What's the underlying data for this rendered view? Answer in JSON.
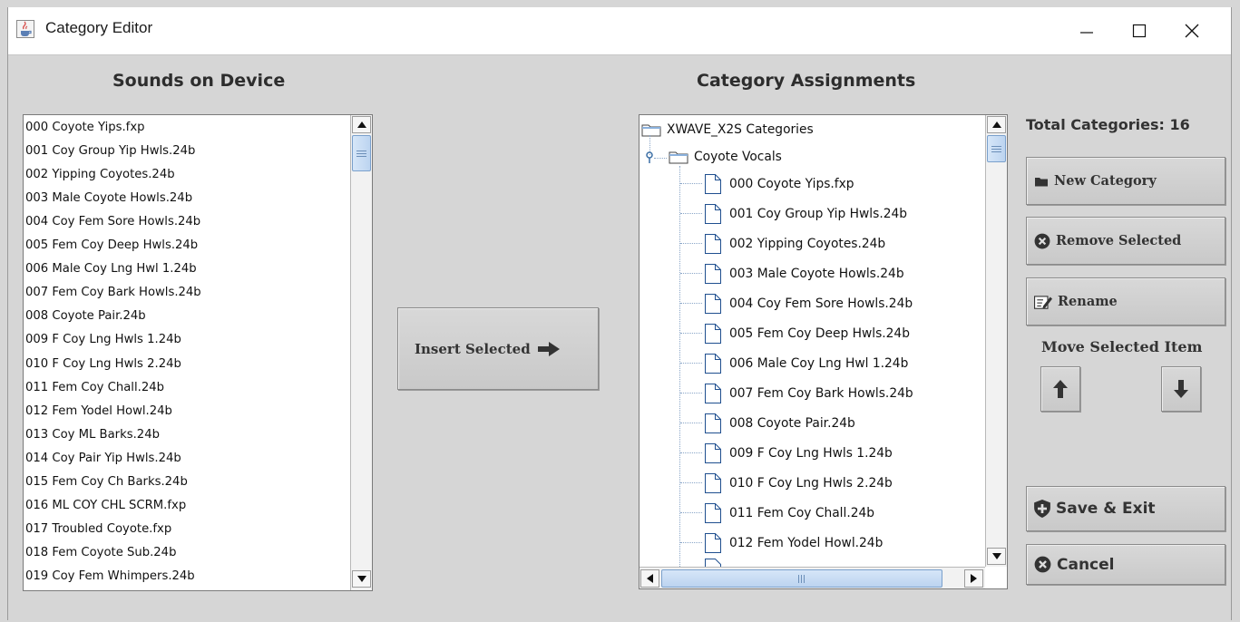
{
  "window": {
    "title": "Category Editor",
    "app_icon": "java-cup-icon",
    "controls": {
      "minimize": "minimize-icon",
      "maximize": "maximize-icon",
      "close": "close-icon"
    }
  },
  "left_panel": {
    "heading": "Sounds on Device",
    "items": [
      "000 Coyote Yips.fxp",
      "001 Coy Group Yip Hwls.24b",
      "002 Yipping Coyotes.24b",
      "003 Male Coyote Howls.24b",
      "004 Coy Fem Sore Howls.24b",
      "005 Fem Coy Deep Hwls.24b",
      "006 Male Coy Lng Hwl 1.24b",
      "007 Fem Coy Bark Howls.24b",
      "008 Coyote Pair.24b",
      "009 F Coy Lng Hwls 1.24b",
      "010 F Coy Lng Hwls 2.24b",
      "011 Fem Coy Chall.24b",
      "012 Fem Yodel Howl.24b",
      "013 Coy ML Barks.24b",
      "014 Coy Pair Yip Hwls.24b",
      "015 Fem Coy Ch Barks.24b",
      "016 ML COY CHL SCRM.fxp",
      "017 Troubled Coyote.fxp",
      "018 Fem Coyote Sub.24b",
      "019 Coy Fem Whimpers.24b"
    ]
  },
  "insert_button": {
    "label": "Insert Selected",
    "icon": "arrow-right-icon"
  },
  "right_panel": {
    "heading": "Category Assignments",
    "root_label": "XWAVE_X2S Categories",
    "category_label": "Coyote Vocals",
    "items": [
      "000 Coyote Yips.fxp",
      "001 Coy Group Yip Hwls.24b",
      "002 Yipping Coyotes.24b",
      "003 Male Coyote Howls.24b",
      "004 Coy Fem Sore Howls.24b",
      "005 Fem Coy Deep Hwls.24b",
      "006 Male Coy Lng Hwl 1.24b",
      "007 Fem Coy Bark Howls.24b",
      "008 Coyote Pair.24b",
      "009 F Coy Lng Hwls 1.24b",
      "010 F Coy Lng Hwls 2.24b",
      "011 Fem Coy Chall.24b",
      "012 Fem Yodel Howl.24b"
    ]
  },
  "sidebar": {
    "total_categories": "Total Categories: 16",
    "new_category": "New Category",
    "remove_selected": "Remove Selected",
    "rename": "Rename",
    "move_label": "Move Selected Item",
    "save_exit": "Save & Exit",
    "cancel": "Cancel"
  }
}
